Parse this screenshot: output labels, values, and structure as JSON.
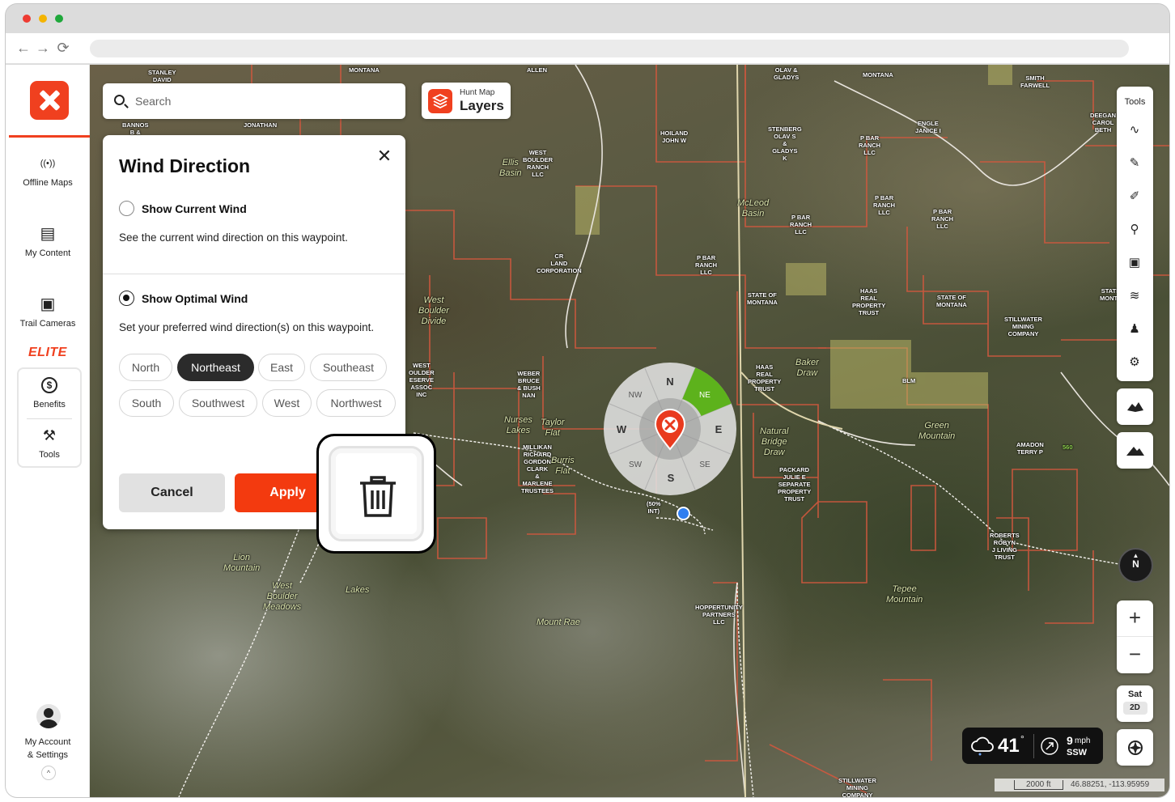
{
  "browser": {
    "nav_back": "←",
    "nav_forward": "→",
    "nav_reload": "⟳"
  },
  "sidebar": {
    "items": [
      {
        "label": "Offline Maps",
        "icon": "broadcast-icon",
        "glyph": "((•))"
      },
      {
        "label": "My Content",
        "icon": "folder-icon",
        "glyph": "▤"
      },
      {
        "label": "Trail Cameras",
        "icon": "camera-icon",
        "glyph": "▣"
      }
    ],
    "elite_badge": "ELITE",
    "elite_items": [
      {
        "label": "Benefits",
        "glyph": "$"
      },
      {
        "label": "Tools",
        "glyph": "⚒"
      }
    ],
    "account_label_1": "My Account",
    "account_label_2": "& Settings",
    "collapse_glyph": "^"
  },
  "search": {
    "placeholder": "Search"
  },
  "layers": {
    "sub_label": "Hunt Map",
    "main_label": "Layers"
  },
  "wind_panel": {
    "title": "Wind Direction",
    "close_glyph": "✕",
    "option_current": {
      "label": "Show Current Wind",
      "description": "See the current wind direction on this waypoint.",
      "selected": false
    },
    "option_optimal": {
      "label": "Show Optimal Wind",
      "description": "Set your preferred wind direction(s) on this waypoint.",
      "selected": true
    },
    "directions": [
      {
        "label": "North",
        "selected": false
      },
      {
        "label": "Northeast",
        "selected": true
      },
      {
        "label": "East",
        "selected": false
      },
      {
        "label": "Southeast",
        "selected": false
      },
      {
        "label": "South",
        "selected": false
      },
      {
        "label": "Southwest",
        "selected": false
      },
      {
        "label": "West",
        "selected": false
      },
      {
        "label": "Northwest",
        "selected": false
      }
    ],
    "cancel_label": "Cancel",
    "apply_label": "Apply"
  },
  "wind_rose": {
    "labels": {
      "N": "N",
      "NE": "NE",
      "E": "E",
      "SE": "SE",
      "S": "S",
      "SW": "SW",
      "W": "W",
      "NW": "NW"
    },
    "highlight": "NE",
    "highlight_color": "#5db21c"
  },
  "tools": {
    "title": "Tools"
  },
  "compass": {
    "label": "N"
  },
  "zoom": {
    "in": "+",
    "out": "−"
  },
  "basemap": {
    "label": "Sat",
    "mode": "2D"
  },
  "weather": {
    "temperature": "41",
    "degree": "°",
    "wind_speed": "9",
    "wind_unit": "mph",
    "wind_dir": "SSW"
  },
  "scale": {
    "distance": "2000 ft",
    "coordinates": "46.88251, -113.95959"
  },
  "map_labels": {
    "stanley": "STANLEY\nDAVID",
    "montana1": "MONTANA",
    "allen": "ALLEN",
    "olav": "OLAV &\nGLADYS",
    "montana2": "MONTANA",
    "smith": "SMITH\nFARWELL",
    "deegan": "DEEGAN\nCAROL\nBETH",
    "bannos": "BANNOS\nB &",
    "jonathan": "JONATHAN",
    "hoiland": "HOILAND\nJOHN W",
    "stenberg": "STENBERG\nOLAV S\n&\nGLADYS\nK",
    "pbar1": "P BAR\nRANCH\nLLC",
    "engle": "ENGLE\nJANICE I",
    "westboulder": "WEST\nBOULDER\nRANCH\nLLC",
    "ellis": "Ellis\nBasin",
    "mcleod": "McLeod\nBasin",
    "pbar2": "P BAR\nRANCH\nLLC",
    "pbar3": "P BAR\nRANCH\nLLC",
    "pbar4": "P BAR\nRANCH\nLLC",
    "crland": "CR\nLAND\nCORPORATION",
    "pbar5": "P BAR\nRANCH\nLLC",
    "sotm1": "STATE OF\nMONTANA",
    "haas1": "HAAS\nREAL\nPROPERTY\nTRUST",
    "sotm2": "STATE OF\nMONTANA",
    "sotm3": "STATE\nMONTA",
    "westbd": "West\nBoulder\nDivide",
    "stillwater1": "STILLWATER\nMINING\nCOMPANY",
    "wbreserve": "WEST\nOULDER\nESERVE\nASSOC\nINC",
    "weber": "WEBER\nBRUCE\n& BUSH\nNAN",
    "haas2": "HAAS\nREAL\nPROPERTY\nTRUST",
    "baker": "Baker\nDraw",
    "blm": "BLM",
    "nurses": "Nurses\nLakes",
    "taylor": "Taylor\nFlat",
    "millikan": "MILLIKAN\nRICHARD\nGORDON\nCLARK\n&\nMARLENE\nTRUSTEES",
    "burris": "Burris\nFlat",
    "natural": "Natural\nBridge\nDraw",
    "greenmtn": "Green\nMountain",
    "amadon": "AMADON\nTERRY P",
    "packard": "PACKARD\nJULIE E\nSEPARATE\nPROPERTY\nTRUST",
    "lion": "Lion\nMountain",
    "wbmeadows": "West\nBoulder\nMeadows",
    "lakes": "Lakes",
    "mountrae": "Mount Rae",
    "roberts": "ROBERTS\nROBYN\nJ LIVING\nTRUST",
    "tepee": "Tepee\nMountain",
    "hoppertunity": "HOPPERTUNITY\nPARTNERS\nLLC",
    "stillwater2": "STILLWATER\nMINING\nCOMPANY",
    "fiftypct": "(50%\nINT)",
    "elev560": "560"
  }
}
